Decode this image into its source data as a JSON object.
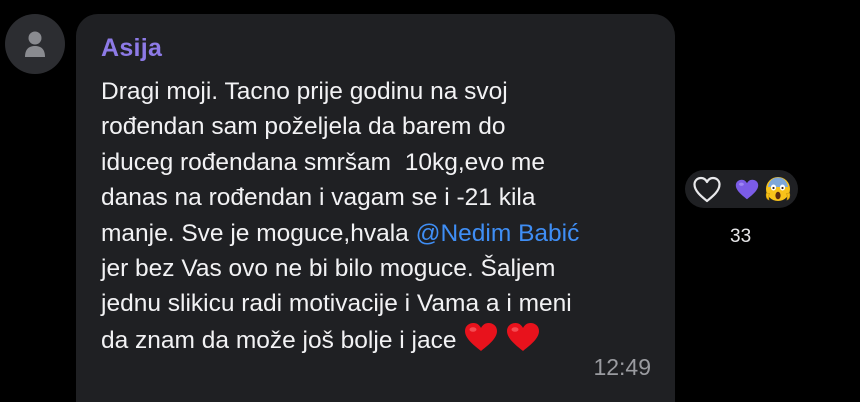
{
  "message": {
    "sender": "Asija",
    "lines": [
      "Dragi moji. Tacno prije godinu na svoj",
      "rođendan sam poželjela da barem do",
      "iduceg rođendana smršam  10kg,evo me",
      "danas na rođendan i vagam se i -21 kila",
      "manje. Sve je moguce,hvala ",
      "jer bez Vas ovo ne bi bilo moguce. Šaljem",
      "jednu slikicu radi motivacije i Vama a i meni",
      "da znam da može još bolje i jace"
    ],
    "mention": "@Nedim Babić",
    "time": "12:49"
  },
  "reactions": {
    "count": "33",
    "icons": [
      "heart-outline",
      "purple-heart",
      "face-screaming-in-fear"
    ]
  },
  "colors": {
    "background": "#000000",
    "bubble": "#1f2023",
    "sender": "#8d7ae6",
    "mention": "#3f8ef5",
    "text": "#f2f2f4",
    "time": "#9a9ba0"
  }
}
